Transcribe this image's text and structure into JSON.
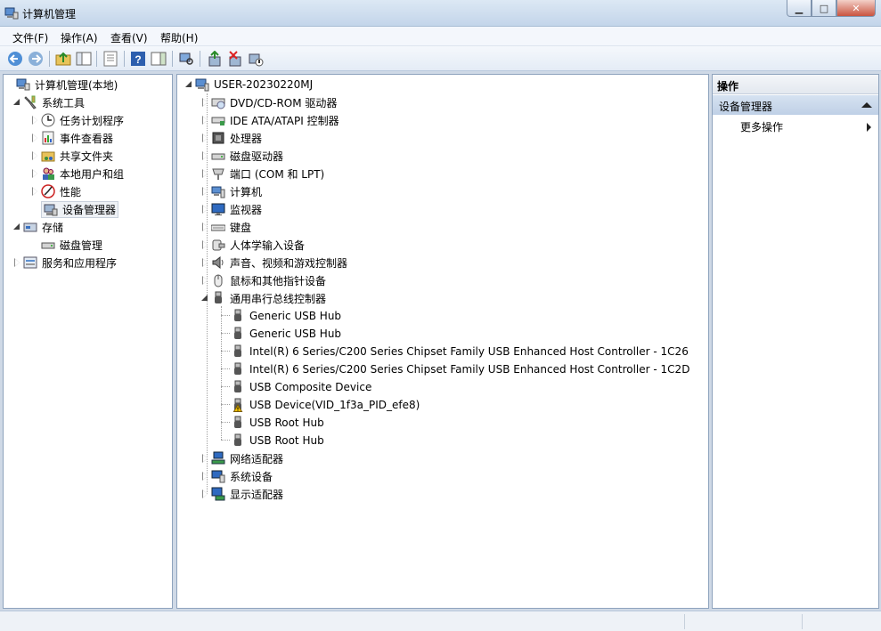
{
  "window": {
    "title": "计算机管理",
    "minimize_glyph": "▁",
    "maximize_glyph": "□",
    "close_glyph": "✕"
  },
  "menu": [
    "文件(F)",
    "操作(A)",
    "查看(V)",
    "帮助(H)"
  ],
  "toolbar": [
    "back-icon",
    "forward-icon",
    "up-folder-icon",
    "show-hide-tree-icon",
    "export-list-icon",
    "help-icon",
    "show-action-pane-icon",
    "scan-hardware-icon",
    "update-driver-icon",
    "uninstall-icon",
    "disable-device-icon"
  ],
  "left_tree": [
    {
      "label": "计算机管理(本地)",
      "icon": "computer-management-icon"
    },
    {
      "label": "系统工具",
      "icon": "system-tools-icon"
    },
    {
      "label": "任务计划程序",
      "icon": "task-scheduler-icon"
    },
    {
      "label": "事件查看器",
      "icon": "event-viewer-icon"
    },
    {
      "label": "共享文件夹",
      "icon": "shared-folders-icon"
    },
    {
      "label": "本地用户和组",
      "icon": "local-users-icon"
    },
    {
      "label": "性能",
      "icon": "performance-icon"
    },
    {
      "label": "设备管理器",
      "icon": "device-manager-icon"
    },
    {
      "label": "存储",
      "icon": "storage-icon"
    },
    {
      "label": "磁盘管理",
      "icon": "disk-management-icon"
    },
    {
      "label": "服务和应用程序",
      "icon": "services-apps-icon"
    }
  ],
  "device_tree": {
    "root": "USER-20230220MJ",
    "categories": [
      "DVD/CD-ROM 驱动器",
      "IDE ATA/ATAPI 控制器",
      "处理器",
      "磁盘驱动器",
      "端口 (COM 和 LPT)",
      "计算机",
      "监视器",
      "键盘",
      "人体学输入设备",
      "声音、视频和游戏控制器",
      "鼠标和其他指针设备",
      "通用串行总线控制器"
    ],
    "usb_children": [
      "Generic USB Hub",
      "Generic USB Hub",
      "Intel(R) 6 Series/C200 Series Chipset Family USB Enhanced Host Controller - 1C26",
      "Intel(R) 6 Series/C200 Series Chipset Family USB Enhanced Host Controller - 1C2D",
      "USB Composite Device",
      "USB Device(VID_1f3a_PID_efe8)",
      "USB Root Hub",
      "USB Root Hub"
    ],
    "after": [
      "网络适配器",
      "系统设备",
      "显示适配器"
    ]
  },
  "actions": {
    "header": "操作",
    "group": "设备管理器",
    "more": "更多操作"
  },
  "colors": {
    "selection": "#eef1f5",
    "warning": "#f2c200",
    "accent": "#3b6fb6"
  }
}
